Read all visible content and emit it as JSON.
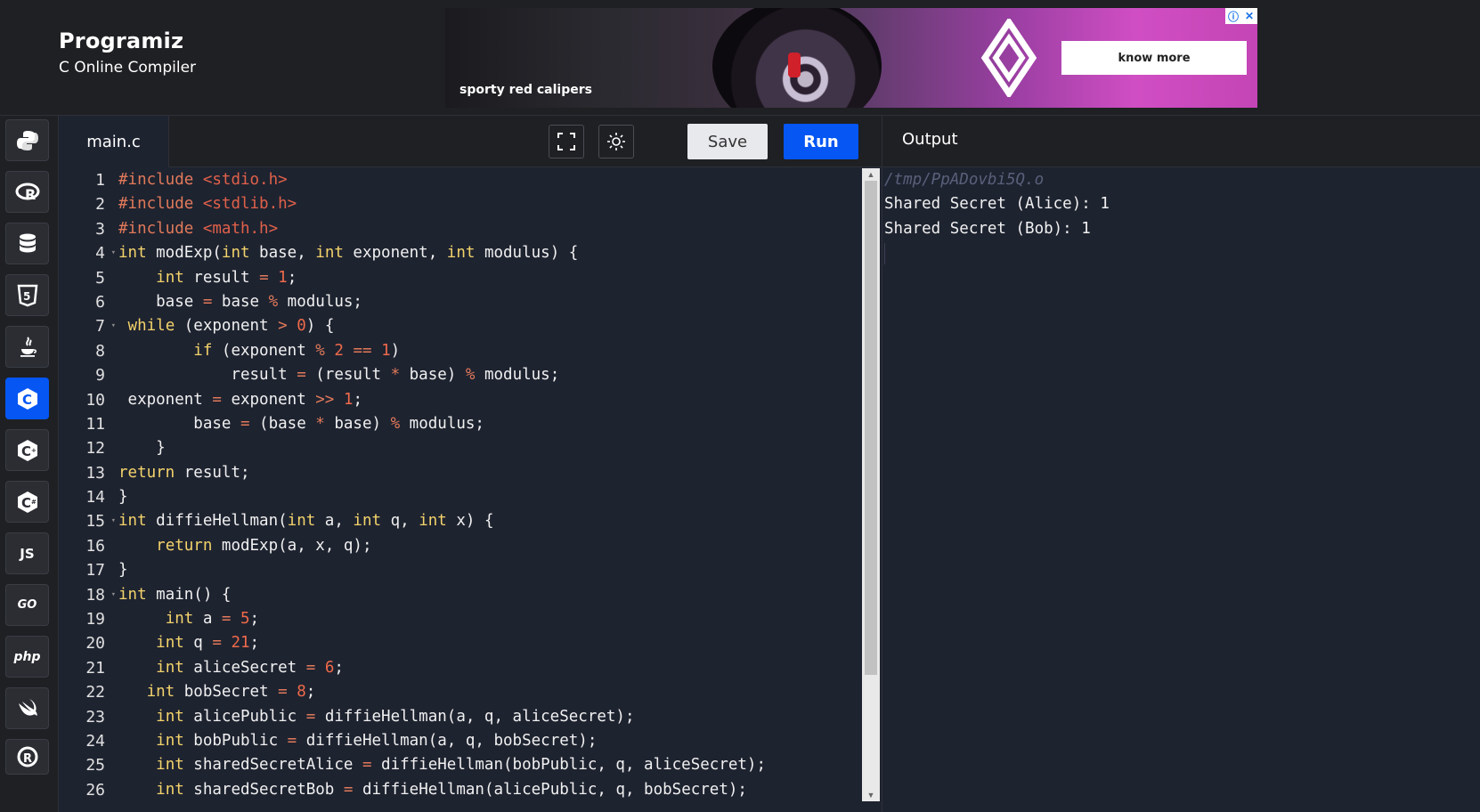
{
  "brand": {
    "name": "Programiz",
    "subtitle": "C Online Compiler"
  },
  "ad": {
    "tagline": "sporty red calipers",
    "cta": "know more"
  },
  "rail": {
    "languages": [
      "python",
      "r",
      "sql",
      "html",
      "java",
      "c",
      "cpp",
      "csharp",
      "JS",
      "GO",
      "php",
      "swift",
      "rust"
    ],
    "active": "c"
  },
  "editor": {
    "tab": "main.c",
    "save_label": "Save",
    "run_label": "Run",
    "line_numbers": [
      "1",
      "2",
      "3",
      "4",
      "5",
      "6",
      "7",
      "8",
      "9",
      "10",
      "11",
      "12",
      "13",
      "14",
      "15",
      "16",
      "17",
      "18",
      "19",
      "20",
      "21",
      "22",
      "23",
      "24",
      "25",
      "26"
    ]
  },
  "output": {
    "title": "Output",
    "path": "/tmp/PpADovbi5Q.o",
    "lines": [
      "Shared Secret (Alice): 1",
      "Shared Secret (Bob): 1"
    ]
  },
  "colors": {
    "run_blue": "#0556f3",
    "editor_bg": "#1e2330",
    "keyword": "#f3d36b",
    "literal": "#ef6a4a"
  }
}
